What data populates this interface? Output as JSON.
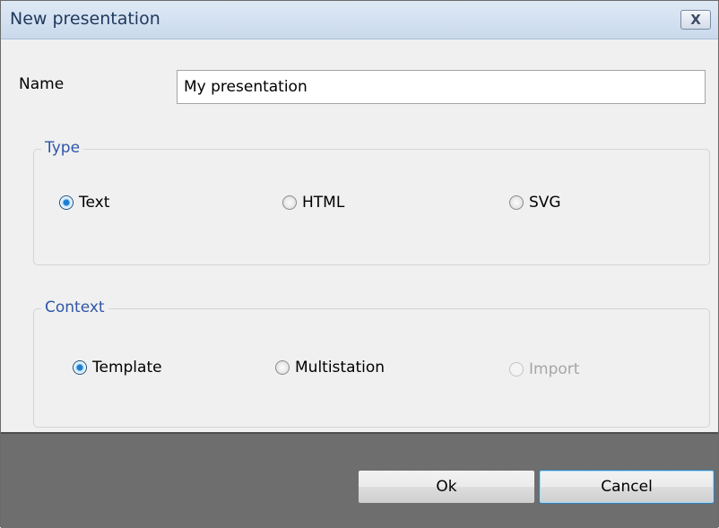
{
  "window": {
    "title": "New presentation",
    "close_glyph": "X"
  },
  "name": {
    "label": "Name",
    "value": "My presentation"
  },
  "type_group": {
    "legend": "Type",
    "options": [
      {
        "label": "Text",
        "checked": true
      },
      {
        "label": "HTML",
        "checked": false
      },
      {
        "label": "SVG",
        "checked": false
      }
    ]
  },
  "context_group": {
    "legend": "Context",
    "options": [
      {
        "label": "Template",
        "checked": true
      },
      {
        "label": "Multistation",
        "checked": false
      },
      {
        "label": "Import",
        "checked": false,
        "disabled": true
      }
    ]
  },
  "buttons": {
    "ok": "Ok",
    "cancel": "Cancel"
  },
  "colors": {
    "legend": "#2f56a6",
    "footer": "#6e6e6e",
    "radio_checked": "#1b7fd1"
  }
}
